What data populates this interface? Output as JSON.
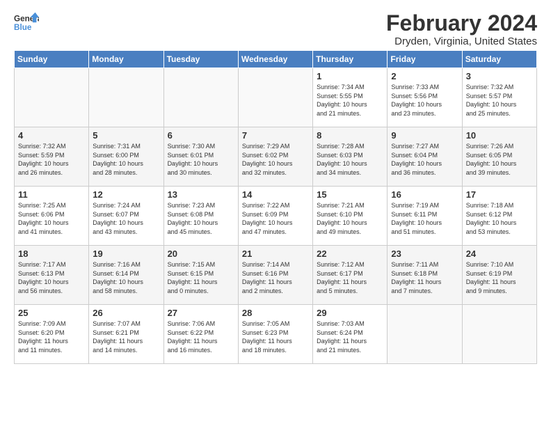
{
  "logo": {
    "line1": "General",
    "line2": "Blue"
  },
  "title": "February 2024",
  "location": "Dryden, Virginia, United States",
  "days_of_week": [
    "Sunday",
    "Monday",
    "Tuesday",
    "Wednesday",
    "Thursday",
    "Friday",
    "Saturday"
  ],
  "weeks": [
    [
      {
        "num": "",
        "info": ""
      },
      {
        "num": "",
        "info": ""
      },
      {
        "num": "",
        "info": ""
      },
      {
        "num": "",
        "info": ""
      },
      {
        "num": "1",
        "info": "Sunrise: 7:34 AM\nSunset: 5:55 PM\nDaylight: 10 hours\nand 21 minutes."
      },
      {
        "num": "2",
        "info": "Sunrise: 7:33 AM\nSunset: 5:56 PM\nDaylight: 10 hours\nand 23 minutes."
      },
      {
        "num": "3",
        "info": "Sunrise: 7:32 AM\nSunset: 5:57 PM\nDaylight: 10 hours\nand 25 minutes."
      }
    ],
    [
      {
        "num": "4",
        "info": "Sunrise: 7:32 AM\nSunset: 5:59 PM\nDaylight: 10 hours\nand 26 minutes."
      },
      {
        "num": "5",
        "info": "Sunrise: 7:31 AM\nSunset: 6:00 PM\nDaylight: 10 hours\nand 28 minutes."
      },
      {
        "num": "6",
        "info": "Sunrise: 7:30 AM\nSunset: 6:01 PM\nDaylight: 10 hours\nand 30 minutes."
      },
      {
        "num": "7",
        "info": "Sunrise: 7:29 AM\nSunset: 6:02 PM\nDaylight: 10 hours\nand 32 minutes."
      },
      {
        "num": "8",
        "info": "Sunrise: 7:28 AM\nSunset: 6:03 PM\nDaylight: 10 hours\nand 34 minutes."
      },
      {
        "num": "9",
        "info": "Sunrise: 7:27 AM\nSunset: 6:04 PM\nDaylight: 10 hours\nand 36 minutes."
      },
      {
        "num": "10",
        "info": "Sunrise: 7:26 AM\nSunset: 6:05 PM\nDaylight: 10 hours\nand 39 minutes."
      }
    ],
    [
      {
        "num": "11",
        "info": "Sunrise: 7:25 AM\nSunset: 6:06 PM\nDaylight: 10 hours\nand 41 minutes."
      },
      {
        "num": "12",
        "info": "Sunrise: 7:24 AM\nSunset: 6:07 PM\nDaylight: 10 hours\nand 43 minutes."
      },
      {
        "num": "13",
        "info": "Sunrise: 7:23 AM\nSunset: 6:08 PM\nDaylight: 10 hours\nand 45 minutes."
      },
      {
        "num": "14",
        "info": "Sunrise: 7:22 AM\nSunset: 6:09 PM\nDaylight: 10 hours\nand 47 minutes."
      },
      {
        "num": "15",
        "info": "Sunrise: 7:21 AM\nSunset: 6:10 PM\nDaylight: 10 hours\nand 49 minutes."
      },
      {
        "num": "16",
        "info": "Sunrise: 7:19 AM\nSunset: 6:11 PM\nDaylight: 10 hours\nand 51 minutes."
      },
      {
        "num": "17",
        "info": "Sunrise: 7:18 AM\nSunset: 6:12 PM\nDaylight: 10 hours\nand 53 minutes."
      }
    ],
    [
      {
        "num": "18",
        "info": "Sunrise: 7:17 AM\nSunset: 6:13 PM\nDaylight: 10 hours\nand 56 minutes."
      },
      {
        "num": "19",
        "info": "Sunrise: 7:16 AM\nSunset: 6:14 PM\nDaylight: 10 hours\nand 58 minutes."
      },
      {
        "num": "20",
        "info": "Sunrise: 7:15 AM\nSunset: 6:15 PM\nDaylight: 11 hours\nand 0 minutes."
      },
      {
        "num": "21",
        "info": "Sunrise: 7:14 AM\nSunset: 6:16 PM\nDaylight: 11 hours\nand 2 minutes."
      },
      {
        "num": "22",
        "info": "Sunrise: 7:12 AM\nSunset: 6:17 PM\nDaylight: 11 hours\nand 5 minutes."
      },
      {
        "num": "23",
        "info": "Sunrise: 7:11 AM\nSunset: 6:18 PM\nDaylight: 11 hours\nand 7 minutes."
      },
      {
        "num": "24",
        "info": "Sunrise: 7:10 AM\nSunset: 6:19 PM\nDaylight: 11 hours\nand 9 minutes."
      }
    ],
    [
      {
        "num": "25",
        "info": "Sunrise: 7:09 AM\nSunset: 6:20 PM\nDaylight: 11 hours\nand 11 minutes."
      },
      {
        "num": "26",
        "info": "Sunrise: 7:07 AM\nSunset: 6:21 PM\nDaylight: 11 hours\nand 14 minutes."
      },
      {
        "num": "27",
        "info": "Sunrise: 7:06 AM\nSunset: 6:22 PM\nDaylight: 11 hours\nand 16 minutes."
      },
      {
        "num": "28",
        "info": "Sunrise: 7:05 AM\nSunset: 6:23 PM\nDaylight: 11 hours\nand 18 minutes."
      },
      {
        "num": "29",
        "info": "Sunrise: 7:03 AM\nSunset: 6:24 PM\nDaylight: 11 hours\nand 21 minutes."
      },
      {
        "num": "",
        "info": ""
      },
      {
        "num": "",
        "info": ""
      }
    ]
  ]
}
